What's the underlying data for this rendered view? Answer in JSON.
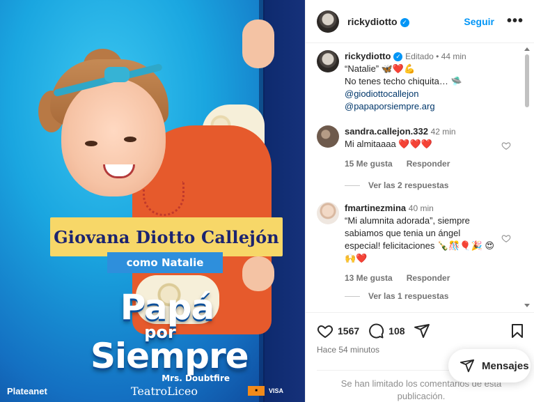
{
  "poster": {
    "name_banner": "Giovana Diotto Callejón",
    "role": "como Natalie",
    "title_line1": "Papá",
    "title_line2": "por",
    "title_line3": "Siempre",
    "subtitle": "Mrs. Doubtfire",
    "sponsor_left": "Plateanet",
    "sponsor_center": "TeatroLiceo",
    "sponsor_right": "VISA"
  },
  "header": {
    "username": "rickydiotto",
    "follow_label": "Seguir",
    "more_label": "•••"
  },
  "caption": {
    "username": "rickydiotto",
    "edited": "Editado",
    "time": "44 min",
    "line1": "“Natalie” 🦋❤️💪",
    "line2": "No tenes techo chiquita… 🛸",
    "mention1": "@giodiottocallejon",
    "mention2": "@papaporsiempre.arg"
  },
  "comments": [
    {
      "username": "sandra.callejon.332",
      "time": "42 min",
      "text": "Mi almitaaaa ❤️❤️❤️",
      "likes": "15 Me gusta",
      "reply": "Responder",
      "replies": "Ver las 2 respuestas"
    },
    {
      "username": "fmartinezmina",
      "time": "40 min",
      "text": "“Mi alumnita adorada”, siempre sabiamos que tenia un ángel especial! felicitaciones 🍾🎊🎈🎉 😍🙌❤️",
      "likes": "13 Me gusta",
      "reply": "Responder",
      "replies": "Ver las 1 respuestas"
    }
  ],
  "actions": {
    "likes_count": "1567",
    "comments_count": "108",
    "time_ago": "Hace 54 minutos",
    "limited_notice": "Se han limitado los comentarios de esta publicación."
  },
  "messages_button": "Mensajes",
  "colors": {
    "accent_blue": "#0095f6",
    "link": "#00376b",
    "heart_red": "#ed4956",
    "banner_yellow": "#f7d768",
    "banner_blue": "#2e8fdc"
  }
}
